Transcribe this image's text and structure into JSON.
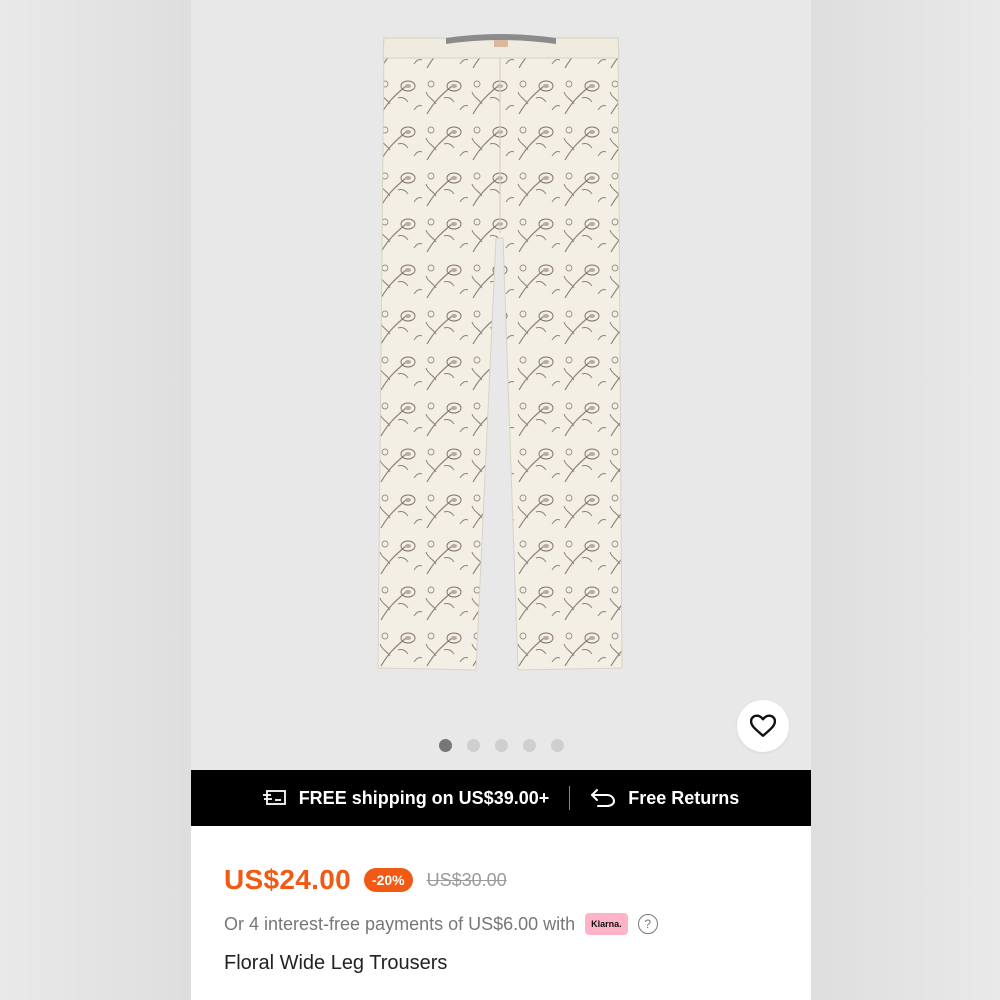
{
  "gallery": {
    "image_alt": "Floral wide leg trousers product photo",
    "image_count": 5,
    "active_index": 0
  },
  "shipping_bar": {
    "shipping_text": "FREE shipping on US$39.00+",
    "returns_text": "Free Returns"
  },
  "product": {
    "price": "US$24.00",
    "discount": "-20%",
    "original_price": "US$30.00",
    "installment_text": "Or 4 interest-free payments of US$6.00 with",
    "installment_provider": "Klarna.",
    "help_symbol": "?",
    "title": "Floral Wide Leg Trousers"
  },
  "colors": {
    "accent": "#f05a14",
    "bar_background": "#000000",
    "klarna_pink": "#ffb3c7"
  },
  "icons": [
    "heart-icon",
    "shipping-truck-icon",
    "return-arrow-icon",
    "help-icon"
  ]
}
